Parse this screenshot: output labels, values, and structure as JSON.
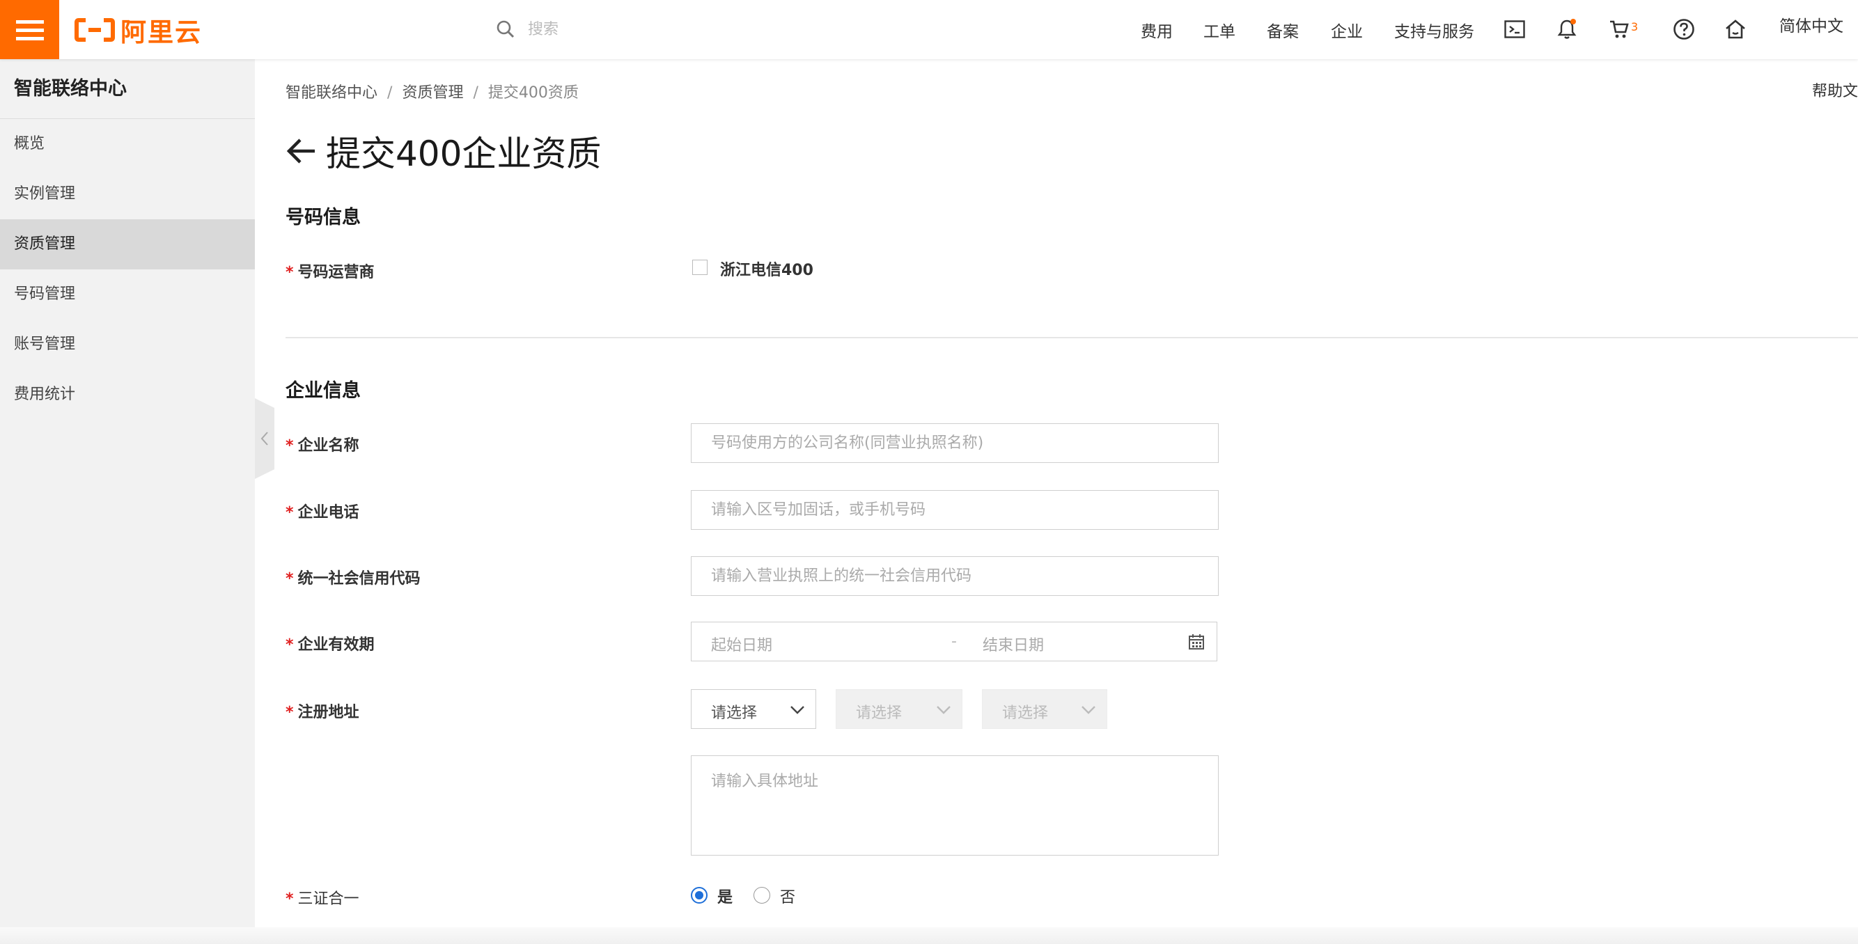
{
  "brand": {
    "logo_text": "阿里云",
    "accent": "#ff6a00"
  },
  "search": {
    "placeholder": "搜索"
  },
  "topnav": {
    "items": [
      "费用",
      "工单",
      "备案",
      "企业",
      "支持与服务"
    ],
    "cart_count": "3",
    "language": "简体中文",
    "icons": [
      "terminal-icon",
      "bell-icon",
      "cart-icon",
      "help-icon",
      "home-icon"
    ]
  },
  "sidebar": {
    "title": "智能联络中心",
    "items": [
      {
        "label": "概览",
        "active": false
      },
      {
        "label": "实例管理",
        "active": false
      },
      {
        "label": "资质管理",
        "active": true
      },
      {
        "label": "号码管理",
        "active": false
      },
      {
        "label": "账号管理",
        "active": false
      },
      {
        "label": "费用统计",
        "active": false
      }
    ]
  },
  "breadcrumb": [
    "智能联络中心",
    "资质管理",
    "提交400资质"
  ],
  "help_link": "帮助文",
  "page_title": "提交400企业资质",
  "number_section": {
    "title": "号码信息",
    "carrier_label": "号码运营商",
    "carrier_option": "浙江电信400"
  },
  "company_section": {
    "title": "企业信息",
    "name_label": "企业名称",
    "name_placeholder": "号码使用方的公司名称(同营业执照名称)",
    "phone_label": "企业电话",
    "phone_placeholder": "请输入区号加固话，或手机号码",
    "credit_label": "统一社会信用代码",
    "credit_placeholder": "请输入营业执照上的统一社会信用代码",
    "validity_label": "企业有效期",
    "start_placeholder": "起始日期",
    "date_sep": "-",
    "end_placeholder": "结束日期",
    "address_label": "注册地址",
    "select_placeholder": "请选择",
    "address_detail_placeholder": "请输入具体地址",
    "three_in_one_label": "三证合一",
    "radio_yes": "是",
    "radio_no": "否",
    "required_mark": "*"
  }
}
